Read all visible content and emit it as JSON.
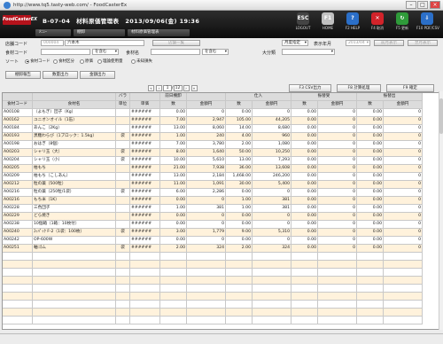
{
  "window": {
    "title": "http://www.tq5.tasty-web.com/ - FoodCasterEx"
  },
  "app": {
    "logo": "FoodCasterEX",
    "screen_title": "B-07-04　材料原価管理表　2013/09/06(金) 19:36",
    "crumbs": [
      "ﾒﾆｭｰ",
      "棚卸",
      "材料原価管理表"
    ],
    "toolbar": [
      {
        "key": "ESC",
        "label": "LOGOUT",
        "color": "#444444",
        "icon": "logout-icon"
      },
      {
        "key": "F1",
        "label": "HOME",
        "color": "#c0c0c0",
        "icon": "home-icon"
      },
      {
        "key": "?",
        "label": "F2 HELP",
        "color": "#2b6fc8",
        "icon": "help-icon"
      },
      {
        "key": "✕",
        "label": "F4 取消",
        "color": "#d2232a",
        "icon": "cancel-icon"
      },
      {
        "key": "↻",
        "label": "F5 更新",
        "color": "#2f9b3a",
        "icon": "refresh-icon"
      },
      {
        "key": "⇩",
        "label": "F10 PDF/CSV",
        "color": "#2b6fc8",
        "icon": "download-icon"
      }
    ]
  },
  "filters": {
    "store_label": "店舗コード",
    "store_code": "000004",
    "store_name": "六本木",
    "store_list_btn": "店舗一覧",
    "month_mode": "月度指定",
    "display_month_label": "表示年月",
    "display_month_value": "2013/04",
    "prev_month_btn": "前月表示",
    "next_month_btn": "翌月表示",
    "food_code_label": "食材コード",
    "food_code_mode": "を含む",
    "food_name_label": "食材名",
    "food_name_mode": "を含む",
    "category_label": "大分類",
    "sort_label": "ソート",
    "sort_options": [
      {
        "label": "食材コード",
        "selected": true
      },
      {
        "label": "食材区分",
        "selected": false
      },
      {
        "label": "原価",
        "selected": false
      },
      {
        "label": "理論使用量",
        "selected": false
      },
      {
        "label": "未知損失",
        "selected": false
      }
    ],
    "btn_stocktake_report": "棚卸報告",
    "btn_stocktake_print": "数量出力",
    "btn_amount_print": "金額出力"
  },
  "actions": {
    "csv": "F3 CSV出力",
    "calc": "F8 計算処理",
    "confirm": "F9 確定"
  },
  "pager": {
    "current": "1",
    "total": "12"
  },
  "table": {
    "headers": {
      "code": "食材コード",
      "name": "食材名",
      "unit_group": "バラ",
      "unit": "単位",
      "price": "単価",
      "opening": "前日棚卸",
      "purchase": "仕入",
      "transfer_in": "振替受",
      "transfer_out": "振替出",
      "qty": "数",
      "amount": "金額円"
    },
    "rows": [
      {
        "code": "A00108",
        "name": "（よもぎ）団子（Kg）",
        "unit": "",
        "price": "######",
        "o_qty": "0.00",
        "o_amt": "0",
        "p_qty": "0.00",
        "p_amt": "0",
        "i_qty": "0.00",
        "i_amt": "0",
        "t_qty": "0.00",
        "t_amt": "0"
      },
      {
        "code": "A00162",
        "name": "ユニオンオイル（1缶）",
        "unit": "",
        "price": "######",
        "o_qty": "7.00",
        "o_amt": "2,947",
        "p_qty": "105.00",
        "p_amt": "44,205",
        "i_qty": "0.00",
        "i_amt": "0",
        "t_qty": "0.00",
        "t_amt": "0"
      },
      {
        "code": "A00184",
        "name": "あんこ（2Kg）",
        "unit": "",
        "price": "######",
        "o_qty": "13.00",
        "o_amt": "8,060",
        "p_qty": "14.00",
        "p_amt": "8,680",
        "i_qty": "0.00",
        "i_amt": "0",
        "t_qty": "0.00",
        "t_amt": "0"
      },
      {
        "code": "A00193",
        "name": "黒糖わらび（1ブロック：1.5kg）",
        "unit": "袋",
        "price": "######",
        "o_qty": "1.00",
        "o_amt": "240",
        "p_qty": "4.00",
        "p_amt": "960",
        "i_qty": "0.00",
        "i_amt": "0",
        "t_qty": "0.00",
        "t_amt": "0"
      },
      {
        "code": "A00198",
        "name": "おはぎ（8個）",
        "unit": "",
        "price": "######",
        "o_qty": "7.00",
        "o_amt": "3,780",
        "p_qty": "2.00",
        "p_amt": "1,080",
        "i_qty": "0.00",
        "i_amt": "0",
        "t_qty": "0.00",
        "t_amt": "0"
      },
      {
        "code": "A00203",
        "name": "シャリ玉（大）",
        "unit": "袋",
        "price": "######",
        "o_qty": "8.00",
        "o_amt": "1,640",
        "p_qty": "50.00",
        "p_amt": "10,250",
        "i_qty": "0.00",
        "i_amt": "0",
        "t_qty": "0.00",
        "t_amt": "0"
      },
      {
        "code": "A00204",
        "name": "シャリ玉（小）",
        "unit": "袋",
        "price": "######",
        "o_qty": "10.00",
        "o_amt": "5,610",
        "p_qty": "13.00",
        "p_amt": "7,293",
        "i_qty": "0.00",
        "i_amt": "0",
        "t_qty": "0.00",
        "t_amt": "0"
      },
      {
        "code": "A00205",
        "name": "柏もち",
        "unit": "",
        "price": "######",
        "o_qty": "21.00",
        "o_amt": "7,938",
        "p_qty": "36.00",
        "p_amt": "13,608",
        "i_qty": "0.00",
        "i_amt": "0",
        "t_qty": "0.00",
        "t_amt": "0"
      },
      {
        "code": "A00209",
        "name": "柏もち（こしあん）",
        "unit": "",
        "price": "######",
        "o_qty": "13.00",
        "o_amt": "2,184",
        "p_qty": "1,468.00",
        "p_amt": "246,200",
        "i_qty": "0.00",
        "i_amt": "0",
        "t_qty": "0.00",
        "t_amt": "0"
      },
      {
        "code": "A00212",
        "name": "粒の薬（500粒）",
        "unit": "",
        "price": "######",
        "o_qty": "11.00",
        "o_amt": "1,091",
        "p_qty": "30.00",
        "p_amt": "5,400",
        "i_qty": "0.00",
        "i_amt": "0",
        "t_qty": "0.00",
        "t_amt": "0"
      },
      {
        "code": "A00216",
        "name": "粒の薬（250粒/1袋）",
        "unit": "袋",
        "price": "######",
        "o_qty": "6.00",
        "o_amt": "2,286",
        "p_qty": "0.00",
        "p_amt": "0",
        "i_qty": "0.00",
        "i_amt": "0",
        "t_qty": "0.00",
        "t_amt": "0"
      },
      {
        "code": "A00216",
        "name": "もち米（1K）",
        "unit": "",
        "price": "######",
        "o_qty": "0.00",
        "o_amt": "0",
        "p_qty": "1.00",
        "p_amt": "381",
        "i_qty": "0.00",
        "i_amt": "0",
        "t_qty": "0.00",
        "t_amt": "0"
      },
      {
        "code": "A00228",
        "name": "三色団子",
        "unit": "",
        "price": "######",
        "o_qty": "1.00",
        "o_amt": "381",
        "p_qty": "1.00",
        "p_amt": "381",
        "i_qty": "0.00",
        "i_amt": "0",
        "t_qty": "0.00",
        "t_amt": "0"
      },
      {
        "code": "A00229",
        "name": "どら焼き",
        "unit": "",
        "price": "######",
        "o_qty": "0.00",
        "o_amt": "0",
        "p_qty": "0.00",
        "p_amt": "0",
        "i_qty": "0.00",
        "i_amt": "0",
        "t_qty": "0.00",
        "t_amt": "0"
      },
      {
        "code": "A00238",
        "name": "10個箱（1箱：10枚付）",
        "unit": "",
        "price": "######",
        "o_qty": "0.00",
        "o_amt": "0",
        "p_qty": "0.00",
        "p_amt": "0",
        "i_qty": "0.00",
        "i_amt": "0",
        "t_qty": "0.00",
        "t_amt": "0"
      },
      {
        "code": "A00240",
        "name": "ｽｯﾊﾟｯｸ F-2（1袋：100枚）",
        "unit": "袋",
        "price": "######",
        "o_qty": "3.00",
        "o_amt": "1,779",
        "p_qty": "9.00",
        "p_amt": "5,310",
        "i_qty": "0.00",
        "i_amt": "0",
        "t_qty": "0.00",
        "t_amt": "0"
      },
      {
        "code": "A00242",
        "name": "OP-600W",
        "unit": "",
        "price": "######",
        "o_qty": "0.00",
        "o_amt": "0",
        "p_qty": "0.00",
        "p_amt": "0",
        "i_qty": "0.00",
        "i_amt": "0",
        "t_qty": "0.00",
        "t_amt": "0"
      },
      {
        "code": "A00251",
        "name": "軸ゴム",
        "unit": "袋",
        "price": "######",
        "o_qty": "2.00",
        "o_amt": "324",
        "p_qty": "2.00",
        "p_amt": "324",
        "i_qty": "0.00",
        "i_amt": "0",
        "t_qty": "0.00",
        "t_amt": "0"
      }
    ]
  }
}
